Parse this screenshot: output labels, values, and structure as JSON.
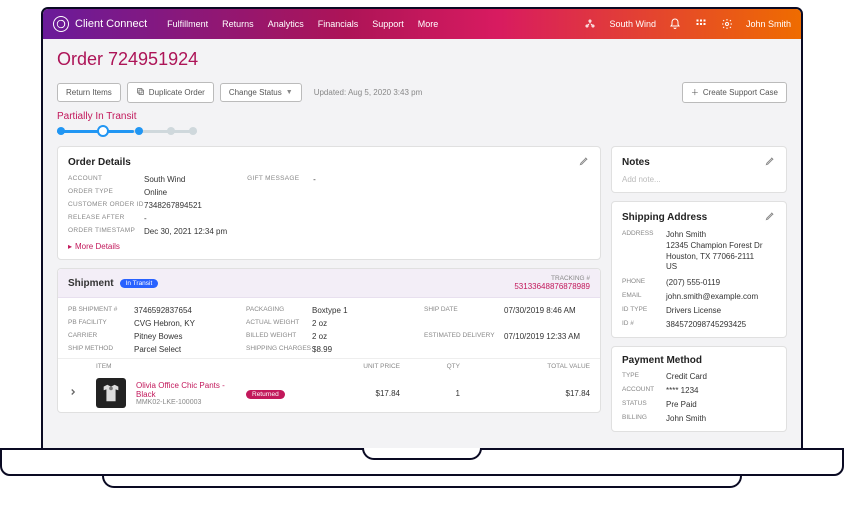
{
  "brand": "Client Connect",
  "nav": {
    "links": [
      "Fulfillment",
      "Returns",
      "Analytics",
      "Financials",
      "Support",
      "More"
    ],
    "org": "South Wind",
    "user": "John Smith"
  },
  "order": {
    "title": "Order 724951924",
    "buttons": {
      "return": "Return Items",
      "duplicate": "Duplicate Order",
      "change_status": "Change Status",
      "create_case": "Create Support Case"
    },
    "updated": "Updated: Aug 5, 2020  3:43 pm",
    "status": "Partially In Transit"
  },
  "details": {
    "heading": "Order Details",
    "account": "South Wind",
    "order_type": "Online",
    "customer_order_id": "7348267894521",
    "release_after": "-",
    "order_timestamp": "Dec 30, 2021 12:34 pm",
    "gift_message_label": "GIFT MESSAGE",
    "gift_message": "-",
    "more": "More Details"
  },
  "shipment": {
    "heading": "Shipment",
    "badge": "In Transit",
    "tracking_label": "TRACKING #",
    "tracking": "53133648876878989",
    "pb_shipment": "3746592837654",
    "pb_facility": "CVG Hebron, KY",
    "carrier": "Pitney Bowes",
    "ship_method": "Parcel Select",
    "packaging": "Boxtype 1",
    "actual_weight": "2 oz",
    "billed_weight": "2 oz",
    "shipping_charges": "$8.99",
    "ship_date": "07/30/2019 8:46 AM",
    "estimated_delivery": "07/10/2019 12:33 AM",
    "cols": {
      "item": "ITEM",
      "unit_price": "UNIT PRICE",
      "qty": "QTY",
      "total": "TOTAL VALUE"
    },
    "line": {
      "name": "Olivia Office Chic Pants - Black",
      "sku": "MMK02-LKE-100003",
      "status": "Returned",
      "unit_price": "$17.84",
      "qty": "1",
      "total": "$17.84"
    }
  },
  "notes": {
    "heading": "Notes",
    "placeholder": "Add note..."
  },
  "shipping": {
    "heading": "Shipping Address",
    "address_label": "ADDRESS",
    "name": "John Smith",
    "street": "12345 Champion Forest Dr",
    "city": "Houston, TX 77066-2111",
    "country": "US",
    "phone_label": "PHONE",
    "phone": "(207) 555-0119",
    "email_label": "EMAIL",
    "email": "john.smith@example.com",
    "id_type_label": "ID TYPE",
    "id_type": "Drivers License",
    "id_num_label": "ID #",
    "id_num": "384572098745293425"
  },
  "payment": {
    "heading": "Payment Method",
    "type_label": "TYPE",
    "type": "Credit Card",
    "account_label": "ACCOUNT",
    "account": "**** 1234",
    "status_label": "STATUS",
    "status": "Pre Paid",
    "billing_label": "BILLING",
    "billing": "John Smith"
  }
}
